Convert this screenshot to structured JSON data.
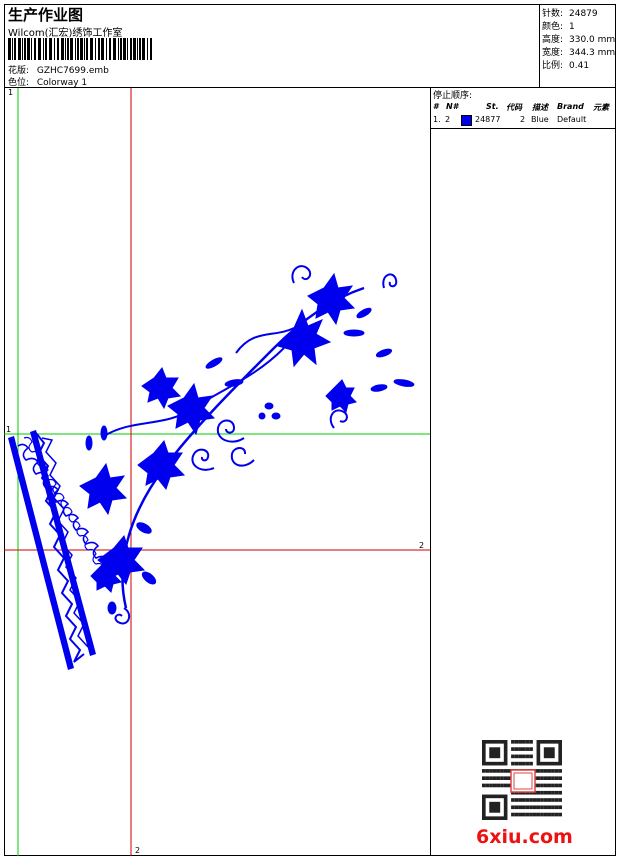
{
  "header": {
    "title": "生产作业图",
    "subtitle": "Wilcom(汇宏)绣饰工作室",
    "design_label": "花版:",
    "design_value": "GZHC7699.emb",
    "colorway_label": "色位:",
    "colorway_value": "Colorway 1",
    "stats": [
      {
        "label": "针数:",
        "value": "24879"
      },
      {
        "label": "颜色:",
        "value": "1"
      },
      {
        "label": "高度:",
        "value": "330.0 mm"
      },
      {
        "label": "宽度:",
        "value": "344.3 mm"
      },
      {
        "label": "比例:",
        "value": "0.41"
      }
    ]
  },
  "stop_sequence": {
    "title": "停止顺序:",
    "columns": [
      "#",
      "N#",
      "St.",
      "代码",
      "描述",
      "Brand",
      "元素"
    ],
    "rows": [
      {
        "num": "1.",
        "needle": "2",
        "color": "#0000ee",
        "stitches": "24877",
        "code": "2",
        "description": "Blue",
        "brand": "Default",
        "element": ""
      }
    ]
  },
  "guides": {
    "vertical_1": "1",
    "horizontal_1": "1",
    "vertical_2": "2",
    "horizontal_2": "2"
  },
  "watermark": {
    "text": "6xiu.com"
  },
  "colors": {
    "design": "#0000ee",
    "guide_green": "#00cc00",
    "guide_red": "#cc0000"
  }
}
